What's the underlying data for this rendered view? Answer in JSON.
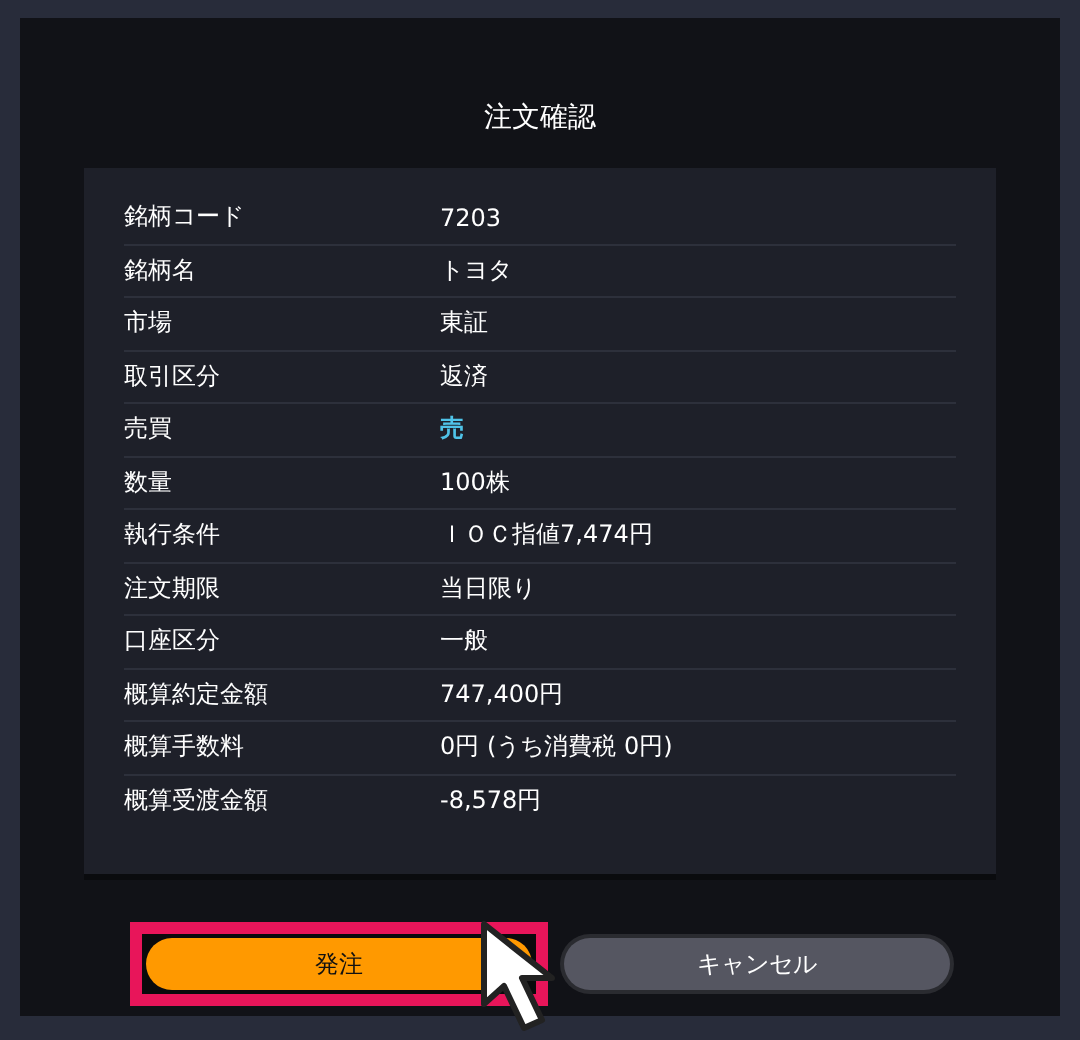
{
  "dialog": {
    "title": "注文確認"
  },
  "rows": [
    {
      "label": "銘柄コード",
      "value": "7203"
    },
    {
      "label": "銘柄名",
      "value": "トヨタ"
    },
    {
      "label": "市場",
      "value": "東証"
    },
    {
      "label": "取引区分",
      "value": "返済"
    },
    {
      "label": "売買",
      "value": "売",
      "color": "#4fc3e8"
    },
    {
      "label": "数量",
      "value": "100株"
    },
    {
      "label": "執行条件",
      "value": "ＩＯＣ指値7,474円"
    },
    {
      "label": "注文期限",
      "value": "当日限り"
    },
    {
      "label": "口座区分",
      "value": "一般"
    },
    {
      "label": "概算約定金額",
      "value": "747,400円"
    },
    {
      "label": "概算手数料",
      "value": "0円 (うち消費税 0円)"
    },
    {
      "label": "概算受渡金額",
      "value": "-8,578円"
    }
  ],
  "buttons": [
    {
      "label": "発注",
      "kind": "primary",
      "highlighted": true
    },
    {
      "label": "キャンセル",
      "kind": "secondary",
      "highlighted": false
    }
  ]
}
